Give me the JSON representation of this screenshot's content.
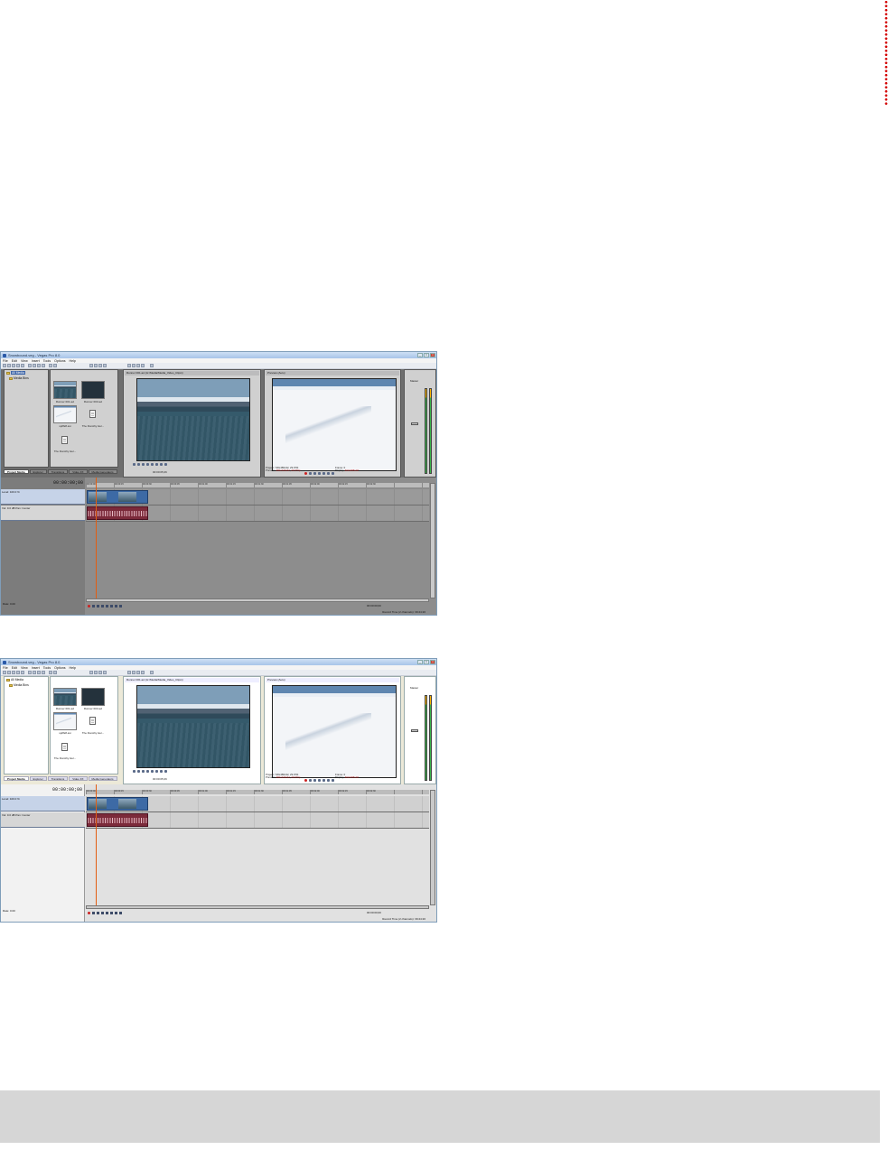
{
  "page": {
    "decor_color": "#d40000",
    "footer_color": "#d6d6d6"
  },
  "screens": [
    {
      "title": "Snowbound.veg - Vegas Pro 8.0",
      "menu": [
        "File",
        "Edit",
        "View",
        "Insert",
        "Tools",
        "Options",
        "Help"
      ],
      "tree": {
        "root": "All Media",
        "child": "Media Bins"
      },
      "media_items": [
        "Runner 001.avi",
        "Runner 003.avi",
        "spiffs8.avi",
        "The Dorothy Her...",
        "The Dorothy Her..."
      ],
      "tabs": [
        "Project Media",
        "Explorer",
        "Transitions",
        "Video FX",
        "Media Generators"
      ],
      "trimmer_header": "Runner 001.avi  (H:\\Media\\Media_Video_Clips\\)",
      "trimmer_tc": "00:00:05;26",
      "preview_dropdown": "Preview (Auto)",
      "preview_meta": {
        "project": "720x480x32, 29.970i",
        "preview": "360x240x32, 29.970p",
        "frame": "0",
        "display": "402x266x32"
      },
      "mixer_label": "Master",
      "timecode": "00:00:00;00",
      "track_level": "Level: 100.0 %",
      "audio_vol": "Vol:",
      "audio_db": "0.0 dB",
      "audio_pan": "Pan:",
      "audio_center": "Center",
      "ruler_ticks": [
        "00:00:00",
        "00:00:15",
        "00:00:30",
        "00:00:45",
        "00:01:00",
        "00:01:15",
        "00:01:30",
        "00:01:45",
        "00:02:00",
        "00:02:15",
        "00:02:30"
      ],
      "rate": "Rate: 0.00",
      "bottom_tc": "00:00:00;00",
      "status": "Record Time (2 channels): 39:24:20"
    },
    {
      "title": "Snowbound.veg - Vegas Pro 8.0",
      "menu": [
        "File",
        "Edit",
        "View",
        "Insert",
        "Tools",
        "Options",
        "Help"
      ],
      "tree": {
        "root": "All Media",
        "child": "Media Bins"
      },
      "media_items": [
        "Runner 001.avi",
        "Runner 003.avi",
        "spiffs8.avi",
        "The Dorothy Her...",
        "The Dorothy Her..."
      ],
      "tabs": [
        "Project Media",
        "Explorer",
        "Transitions",
        "Video FX",
        "Media Generators"
      ],
      "trimmer_header": "Runner 001.avi  (H:\\Media\\Media_Video_Clips\\)",
      "trimmer_tc": "00:00:05;26",
      "preview_dropdown": "Preview (Auto)",
      "preview_meta": {
        "project": "720x480x32, 29.970i",
        "preview": "360x240x32, 29.970p",
        "frame": "0",
        "display": "402x266x32"
      },
      "mixer_label": "Master",
      "timecode": "00:00:00;00",
      "track_level": "Level: 100.0 %",
      "audio_vol": "Vol:",
      "audio_db": "0.0 dB",
      "audio_pan": "Pan:",
      "audio_center": "Center",
      "ruler_ticks": [
        "00:00:00",
        "00:00:15",
        "00:00:30",
        "00:00:45",
        "00:01:00",
        "00:01:15",
        "00:01:30",
        "00:01:45",
        "00:02:00",
        "00:02:15",
        "00:02:30"
      ],
      "rate": "Rate: 0.00",
      "bottom_tc": "00:00:00;00",
      "status": "Record Time (2 channels): 39:24:20"
    }
  ]
}
